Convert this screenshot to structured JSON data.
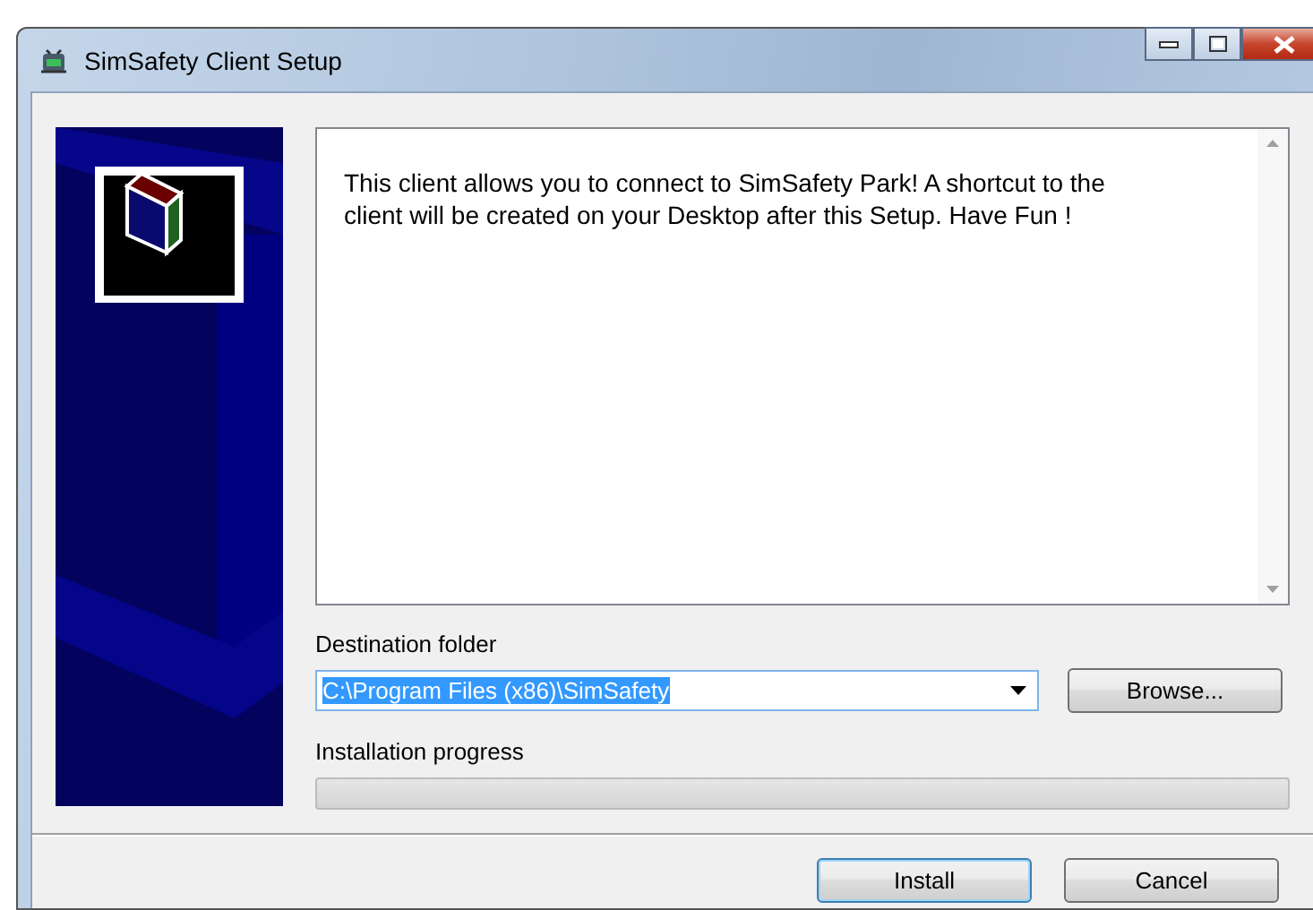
{
  "window": {
    "title": "SimSafety Client Setup"
  },
  "message": "This client allows you to connect to SimSafety Park! A shortcut to the client will be created on your Desktop after this Setup. Have Fun !",
  "destination": {
    "label": "Destination folder",
    "value": "C:\\Program Files (x86)\\SimSafety",
    "selected": true,
    "browse": "Browse..."
  },
  "progress": {
    "label": "Installation progress",
    "level": 0
  },
  "buttons": [
    {
      "label": "Install",
      "default": true
    },
    {
      "label": "Cancel",
      "default": false
    }
  ]
}
